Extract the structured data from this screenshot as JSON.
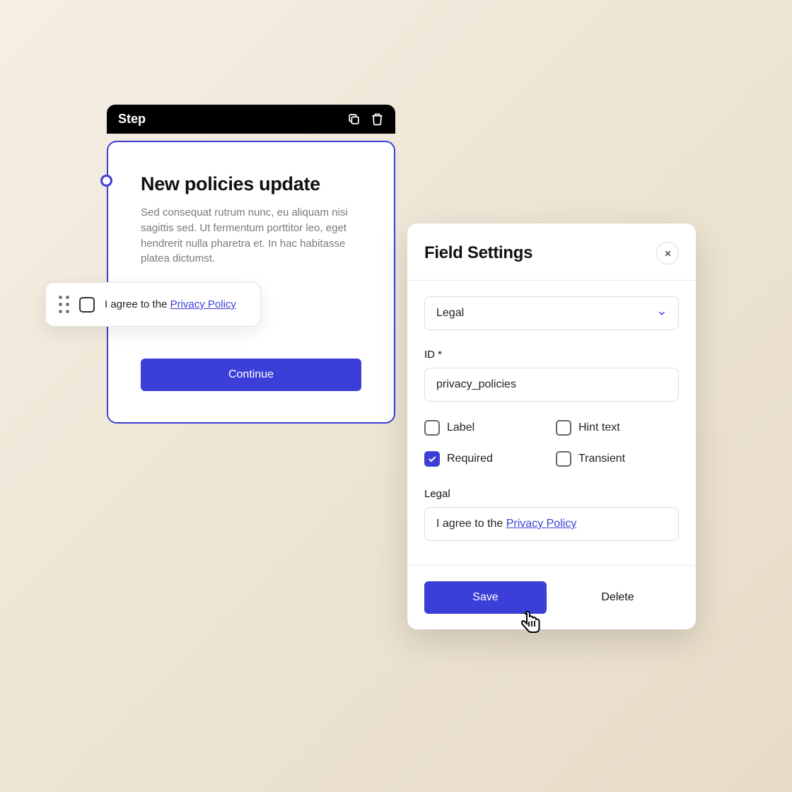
{
  "step": {
    "header_label": "Step",
    "title": "New policies update",
    "description": "Sed consequat rutrum nunc, eu aliquam nisi sagittis sed. Ut fermentum porttitor leo, eget hendrerit nulla pharetra et. In hac habitasse platea dictumst.",
    "continue_label": "Continue"
  },
  "legal_pill": {
    "text_prefix": "I agree to the ",
    "link_text": "Privacy Policy"
  },
  "settings": {
    "title": "Field Settings",
    "type_select": "Legal",
    "id_label": "ID *",
    "id_value": "privacy_policies",
    "checks": {
      "label": {
        "text": "Label",
        "checked": false
      },
      "hint": {
        "text": "Hint text",
        "checked": false
      },
      "required": {
        "text": "Required",
        "checked": true
      },
      "transient": {
        "text": "Transient",
        "checked": false
      }
    },
    "legal_label": "Legal",
    "legal_prefix": "I agree to the ",
    "legal_link": "Privacy Policy",
    "save_label": "Save",
    "delete_label": "Delete"
  },
  "colors": {
    "primary": "#3B3FD8"
  }
}
